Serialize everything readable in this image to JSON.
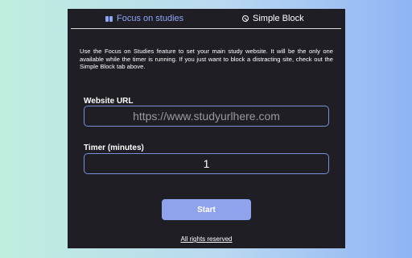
{
  "tabs": [
    {
      "label": "Focus on studies",
      "icon": "book-icon",
      "active": true
    },
    {
      "label": "Simple Block",
      "icon": "block-icon",
      "active": false
    }
  ],
  "description": "Use the Focus on Studies feature to set your main study website. It will be the only one available while the timer is running. If you just want to block a distracting site, check out the Simple Block tab above.",
  "website_url": {
    "label": "Website URL",
    "placeholder": "https://www.studyurlhere.com",
    "value": ""
  },
  "timer": {
    "label": "Timer (minutes)",
    "value": "1"
  },
  "start_button": {
    "label": "Start"
  },
  "footer": {
    "link": "All rights reserved"
  },
  "colors": {
    "accent": "#8fa3ec",
    "panel_bg": "#1f1e24",
    "input_border": "#7b8fd8"
  }
}
